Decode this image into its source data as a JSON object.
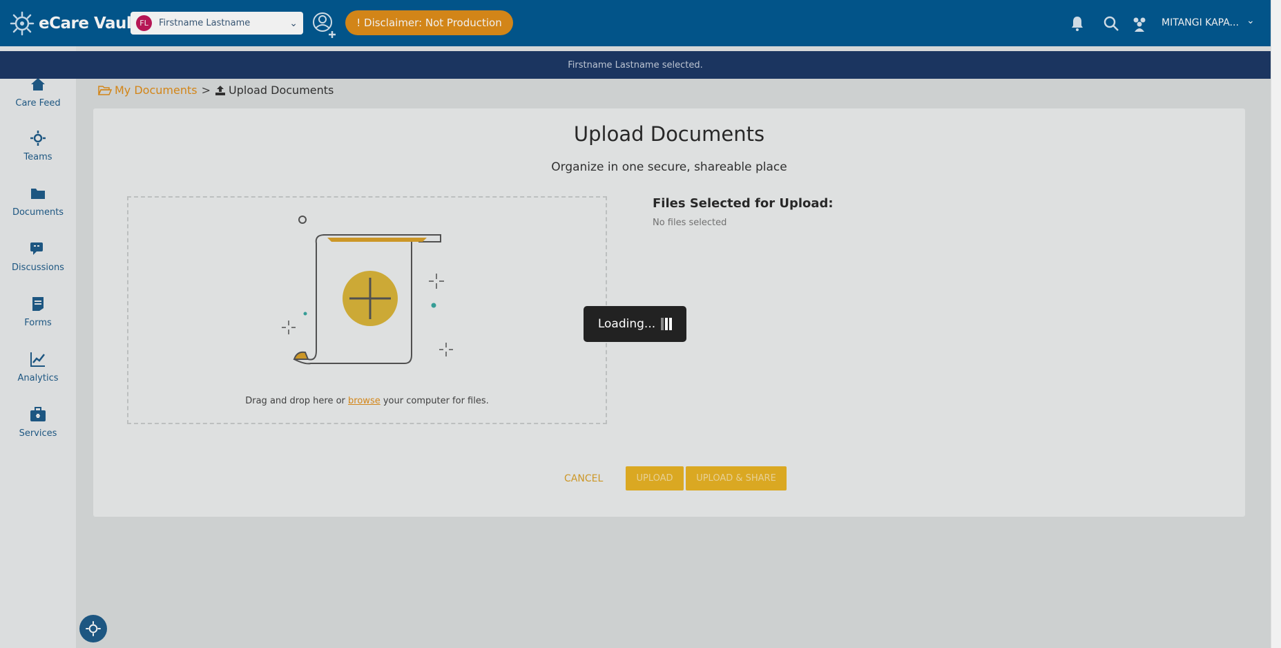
{
  "app": {
    "name": "eCare Vault"
  },
  "header": {
    "patient_initials": "FL",
    "patient_name": "Firstname Lastname",
    "disclaimer": "! Disclaimer: Not Production",
    "user_name": "MITANGI KAPA...",
    "icons": [
      "bell-icon",
      "search-icon",
      "group-icon"
    ]
  },
  "notification": {
    "text": "Firstname Lastname selected."
  },
  "sidebar": {
    "items": [
      {
        "label": "Care Feed",
        "icon": "home-icon"
      },
      {
        "label": "Teams",
        "icon": "team-icon"
      },
      {
        "label": "Documents",
        "icon": "folder-icon"
      },
      {
        "label": "Discussions",
        "icon": "chat-icon"
      },
      {
        "label": "Forms",
        "icon": "form-icon"
      },
      {
        "label": "Analytics",
        "icon": "chart-icon"
      },
      {
        "label": "Services",
        "icon": "briefcase-icon"
      }
    ]
  },
  "breadcrumb": {
    "root": "My Documents",
    "separator": ">",
    "current": "Upload Documents"
  },
  "upload": {
    "title": "Upload Documents",
    "subtitle": "Organize in one secure, shareable place",
    "drop_text_before": "Drag and drop here or",
    "drop_link": "browse",
    "drop_text_after": "your computer for files.",
    "files_title": "Files Selected for Upload:",
    "files_empty": "No files selected",
    "cancel": "CANCEL",
    "upload": "UPLOAD",
    "upload_share": "UPLOAD & SHARE"
  },
  "loading": {
    "text": "Loading..."
  },
  "colors": {
    "header": "#035a92",
    "notification": "#1d3967",
    "accent": "#e08e1a",
    "button": "#e8b325"
  }
}
